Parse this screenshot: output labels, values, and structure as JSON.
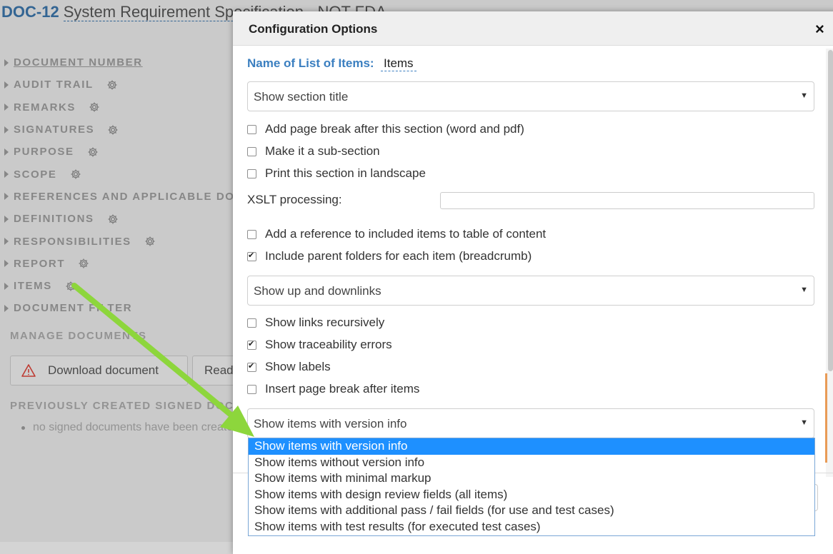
{
  "header": {
    "doc_id": "DOC-12",
    "doc_title": "System Requirement Specification - NOT FDA"
  },
  "toc": [
    {
      "label": "DOCUMENT NUMBER",
      "gear": false,
      "underline": true
    },
    {
      "label": "AUDIT TRAIL",
      "gear": true
    },
    {
      "label": "REMARKS",
      "gear": true
    },
    {
      "label": "SIGNATURES",
      "gear": true
    },
    {
      "label": "PURPOSE",
      "gear": true
    },
    {
      "label": "SCOPE",
      "gear": true
    },
    {
      "label": "REFERENCES AND APPLICABLE DOCUMENTS",
      "gear": false
    },
    {
      "label": "DEFINITIONS",
      "gear": true
    },
    {
      "label": "RESPONSIBILITIES",
      "gear": true
    },
    {
      "label": "REPORT",
      "gear": true
    },
    {
      "label": "ITEMS",
      "gear": true
    },
    {
      "label": "DOCUMENT FILTER",
      "gear": false
    }
  ],
  "manage": {
    "heading": "MANAGE DOCUMENTS",
    "download_label": "Download document",
    "ready_label": "Ready",
    "signed_heading": "PREVIOUSLY CREATED SIGNED DOCUMENTS",
    "signed_empty": "no signed documents have been created"
  },
  "modal": {
    "title": "Configuration Options",
    "close": "×",
    "name_label": "Name of List of Items:",
    "name_value": "Items",
    "section_title_select": "Show section title",
    "checks1": [
      {
        "label": "Add page break after this section (word and pdf)",
        "checked": false
      },
      {
        "label": "Make it a sub-section",
        "checked": false
      },
      {
        "label": "Print this section in landscape",
        "checked": false
      }
    ],
    "xslt_label": "XSLT processing:",
    "xslt_value": "",
    "checks2": [
      {
        "label": "Add a reference to included items to table of content",
        "checked": false
      },
      {
        "label": "Include parent folders for each item (breadcrumb)",
        "checked": true
      }
    ],
    "links_select": "Show up and downlinks",
    "checks3": [
      {
        "label": "Show links recursively",
        "checked": false
      },
      {
        "label": "Show traceability errors",
        "checked": true
      },
      {
        "label": "Show labels",
        "checked": true
      },
      {
        "label": "Insert page break after items",
        "checked": false
      }
    ],
    "version_select": "Show items with version info",
    "version_options": [
      "Show items with version info",
      "Show items without version info",
      "Show items with minimal markup",
      "Show items with design review fields (all items)",
      "Show items with additional pass / fail fields (for use and test cases)",
      "Show items with test results (for executed test cases)"
    ],
    "version_selected_index": 0
  },
  "colors": {
    "accent": "#3b7fc0",
    "selected": "#1e90ff",
    "arrow": "#8dd63c",
    "warning": "#d9443a"
  }
}
